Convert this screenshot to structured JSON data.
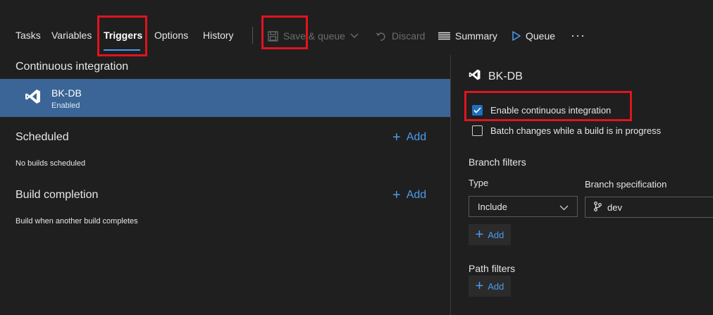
{
  "tabs": [
    {
      "label": "Tasks"
    },
    {
      "label": "Variables"
    },
    {
      "label": "Triggers"
    },
    {
      "label": "Options"
    },
    {
      "label": "History"
    }
  ],
  "toolbar": {
    "save_queue": "Save & queue",
    "discard": "Discard",
    "summary": "Summary",
    "queue": "Queue",
    "more": "···"
  },
  "left": {
    "ci_title": "Continuous integration",
    "ci_item": {
      "name": "BK-DB",
      "status": "Enabled"
    },
    "scheduled_title": "Scheduled",
    "scheduled_add": "Add",
    "scheduled_empty": "No builds scheduled",
    "completion_title": "Build completion",
    "completion_add": "Add",
    "completion_desc": "Build when another build completes"
  },
  "right": {
    "title": "BK-DB",
    "enable_ci": {
      "label": "Enable continuous integration",
      "checked": true
    },
    "batch": {
      "label": "Batch changes while a build is in progress",
      "checked": false
    },
    "branch_filters_title": "Branch filters",
    "type_label": "Type",
    "branch_spec_label": "Branch specification",
    "type_value": "Include",
    "branch_value": "dev",
    "branch_add": "Add",
    "path_filters_title": "Path filters",
    "path_add": "Add"
  },
  "colors": {
    "accent": "#4a9cf0",
    "selected_row": "#3a6596",
    "highlight_box": "#e0141e"
  }
}
